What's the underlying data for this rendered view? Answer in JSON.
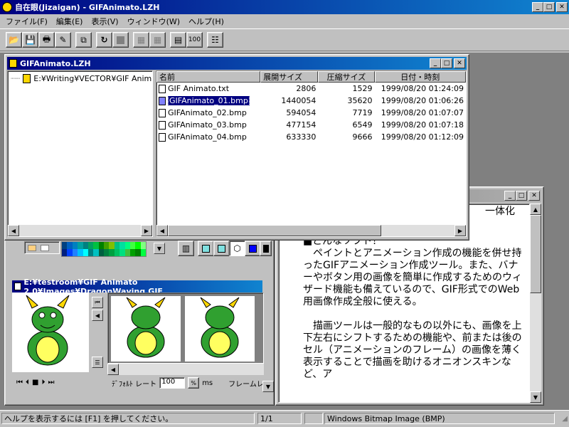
{
  "app": {
    "title": "自在眼(Jizaigan) - GIFAnimato.LZH",
    "menu": [
      "ファイル(F)",
      "編集(E)",
      "表示(V)",
      "ウィンドウ(W)",
      "ヘルプ(H)"
    ],
    "toolbar_100": "100"
  },
  "archive": {
    "title": "GIFAnimato.LZH",
    "tree_item": "E:¥Writing¥VECTOR¥GIF Animato",
    "columns": [
      "名前",
      "展開サイズ",
      "圧縮サイズ",
      "日付・時刻"
    ],
    "files": [
      {
        "name": "GIF Animato.txt",
        "size": "2806",
        "packed": "1529",
        "date": "1999/08/20 01:24:09"
      },
      {
        "name": "GIFAnimato_01.bmp",
        "size": "1440054",
        "packed": "35620",
        "date": "1999/08/20 01:06:26"
      },
      {
        "name": "GIFAnimato_02.bmp",
        "size": "594054",
        "packed": "7719",
        "date": "1999/08/20 01:07:07"
      },
      {
        "name": "GIFAnimato_03.bmp",
        "size": "477154",
        "packed": "6549",
        "date": "1999/08/20 01:07:18"
      },
      {
        "name": "GIFAnimato_04.bmp",
        "size": "633330",
        "packed": "9666",
        "date": "1999/08/20 01:12:09"
      }
    ]
  },
  "gif_window": {
    "title": "E:¥testroom¥GIF Animato 2.0¥Images¥DragonWaving.GIF",
    "rate_label": "ﾃﾞﾌｫﾙﾄ レート",
    "rate_value": "100",
    "rate_unit": "ms",
    "frame_label": "フレームレ"
  },
  "text_window": {
    "partial_top": "一体化",
    "heading": "■どんなソフト？",
    "para1": "　ペイントとアニメーション作成の機能を併せ持ったGIFアニメーション作成ツール。また、バナーやボタン用の画像を簡単に作成するためのウィザード機能も備えているので、GIF形式でのWeb用画像作成全般に使える。",
    "para2": "　描画ツールは一般的なもの以外にも、画像を上下左右にシフトするための機能や、前または後のセル（アニメーションのフレーム）の画像を薄く表示することで描画を助けるオニオンスキンなど、ア"
  },
  "status": {
    "help": "ヘルプを表示するには [F1] を押してください。",
    "position": "1/1",
    "type": "Windows Bitmap Image (BMP)"
  }
}
